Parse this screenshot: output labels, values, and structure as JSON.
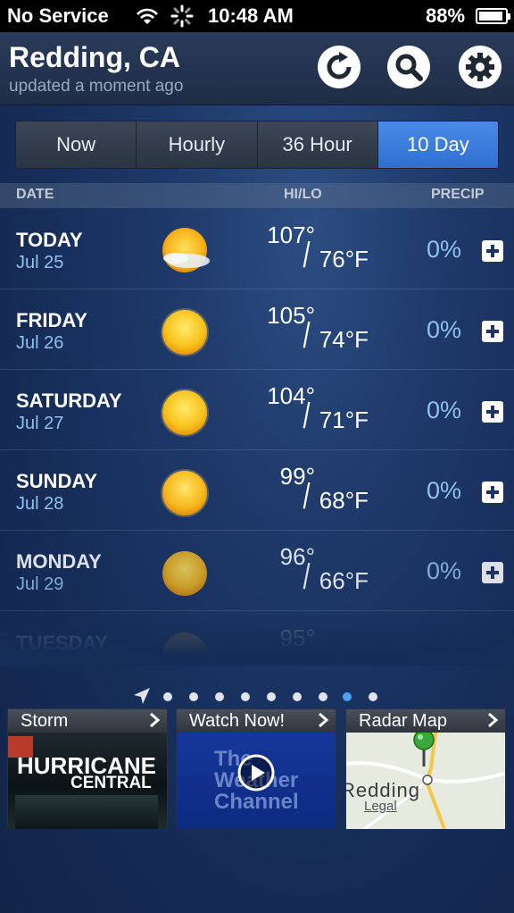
{
  "status_bar": {
    "carrier": "No Service",
    "time": "10:48 AM",
    "battery": "88%"
  },
  "header": {
    "city": "Redding, CA",
    "updated": "updated a moment ago"
  },
  "tabs": [
    "Now",
    "Hourly",
    "36 Hour",
    "10 Day"
  ],
  "active_tab": "10 Day",
  "columns": {
    "date": "DATE",
    "hilo": "HI/LO",
    "precip": "PRECIP"
  },
  "forecast": [
    {
      "day": "TODAY",
      "date": "Jul 25",
      "hi": "107°",
      "lo": "76°F",
      "precip": "0%",
      "icon": "sun-with-cloud-icon"
    },
    {
      "day": "FRIDAY",
      "date": "Jul 26",
      "hi": "105°",
      "lo": "74°F",
      "precip": "0%",
      "icon": "sun-icon"
    },
    {
      "day": "SATURDAY",
      "date": "Jul 27",
      "hi": "104°",
      "lo": "71°F",
      "precip": "0%",
      "icon": "sun-icon"
    },
    {
      "day": "SUNDAY",
      "date": "Jul 28",
      "hi": "99°",
      "lo": "68°F",
      "precip": "0%",
      "icon": "sun-icon"
    },
    {
      "day": "MONDAY",
      "date": "Jul 29",
      "hi": "96°",
      "lo": "66°F",
      "precip": "0%",
      "icon": "sun-icon"
    },
    {
      "day": "TUESDAY",
      "hi": "95°"
    }
  ],
  "cards": [
    {
      "label": "Storm",
      "art_text": [
        "HURRICANE",
        "CENTRAL"
      ]
    },
    {
      "label": "Watch Now!",
      "art_text": [
        "The",
        "Weather",
        "Channel"
      ]
    },
    {
      "label": "Radar Map",
      "art_text": [
        "Redding",
        "Legal"
      ]
    }
  ],
  "colors": {
    "accent": "#3a7fe0",
    "precip_text": "#8fc0ef",
    "active_dot": "#4aa3f2"
  },
  "page_dots": {
    "count": 9,
    "active_index": 7
  }
}
